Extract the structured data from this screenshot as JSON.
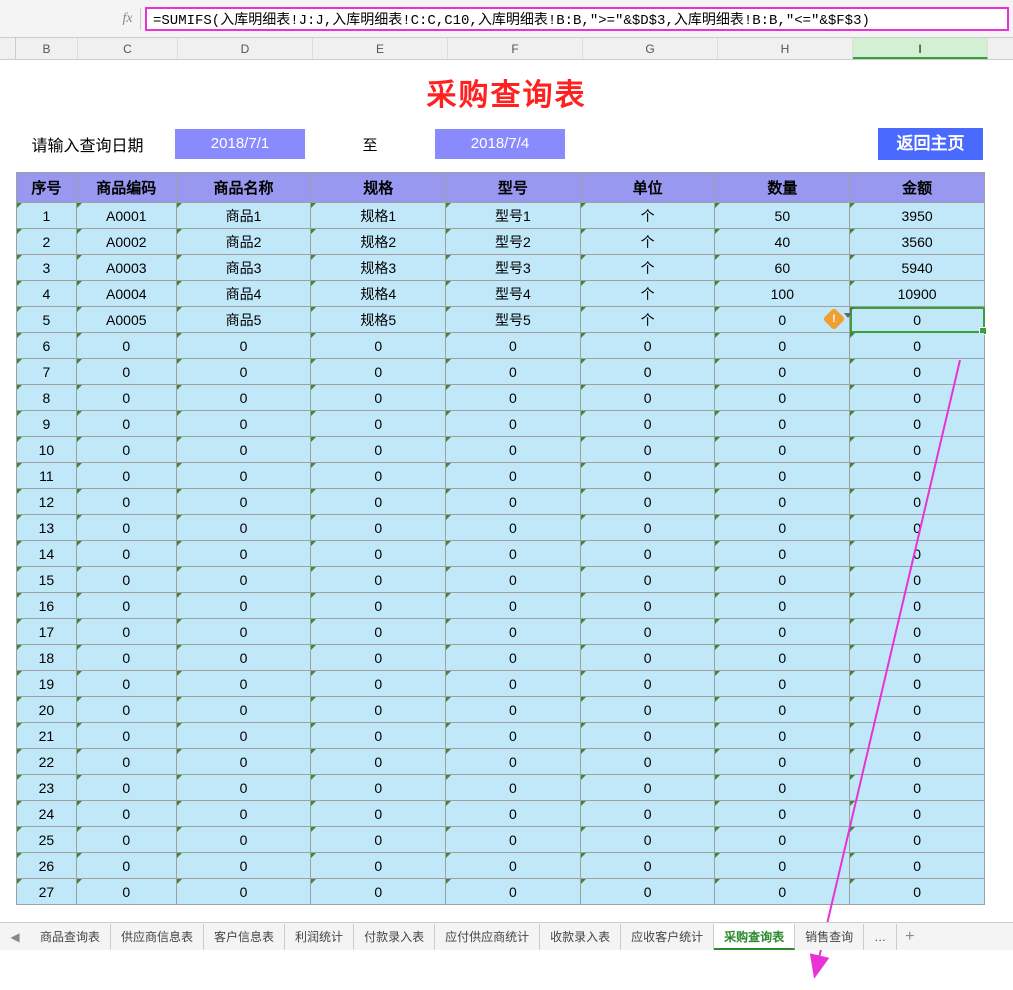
{
  "formula": "=SUMIFS(入库明细表!J:J,入库明细表!C:C,C10,入库明细表!B:B,\">=\"&$D$3,入库明细表!B:B,\"<=\"&$F$3)",
  "fx_label": "fx",
  "columns": [
    "B",
    "C",
    "D",
    "E",
    "F",
    "G",
    "H",
    "I"
  ],
  "selected_col": "I",
  "title": "采购查询表",
  "filter": {
    "label": "请输入查询日期",
    "date_from": "2018/7/1",
    "sep": "至",
    "date_to": "2018/7/4",
    "home": "返回主页"
  },
  "headers": [
    "序号",
    "商品编码",
    "商品名称",
    "规格",
    "型号",
    "单位",
    "数量",
    "金额"
  ],
  "rows": [
    {
      "n": "1",
      "code": "A0001",
      "name": "商品1",
      "spec": "规格1",
      "model": "型号1",
      "unit": "个",
      "qty": "50",
      "amt": "3950"
    },
    {
      "n": "2",
      "code": "A0002",
      "name": "商品2",
      "spec": "规格2",
      "model": "型号2",
      "unit": "个",
      "qty": "40",
      "amt": "3560"
    },
    {
      "n": "3",
      "code": "A0003",
      "name": "商品3",
      "spec": "规格3",
      "model": "型号3",
      "unit": "个",
      "qty": "60",
      "amt": "5940"
    },
    {
      "n": "4",
      "code": "A0004",
      "name": "商品4",
      "spec": "规格4",
      "model": "型号4",
      "unit": "个",
      "qty": "100",
      "amt": "10900"
    },
    {
      "n": "5",
      "code": "A0005",
      "name": "商品5",
      "spec": "规格5",
      "model": "型号5",
      "unit": "个",
      "qty": "0",
      "amt": "0"
    },
    {
      "n": "6",
      "code": "0",
      "name": "0",
      "spec": "0",
      "model": "0",
      "unit": "0",
      "qty": "0",
      "amt": "0"
    },
    {
      "n": "7",
      "code": "0",
      "name": "0",
      "spec": "0",
      "model": "0",
      "unit": "0",
      "qty": "0",
      "amt": "0"
    },
    {
      "n": "8",
      "code": "0",
      "name": "0",
      "spec": "0",
      "model": "0",
      "unit": "0",
      "qty": "0",
      "amt": "0"
    },
    {
      "n": "9",
      "code": "0",
      "name": "0",
      "spec": "0",
      "model": "0",
      "unit": "0",
      "qty": "0",
      "amt": "0"
    },
    {
      "n": "10",
      "code": "0",
      "name": "0",
      "spec": "0",
      "model": "0",
      "unit": "0",
      "qty": "0",
      "amt": "0"
    },
    {
      "n": "11",
      "code": "0",
      "name": "0",
      "spec": "0",
      "model": "0",
      "unit": "0",
      "qty": "0",
      "amt": "0"
    },
    {
      "n": "12",
      "code": "0",
      "name": "0",
      "spec": "0",
      "model": "0",
      "unit": "0",
      "qty": "0",
      "amt": "0"
    },
    {
      "n": "13",
      "code": "0",
      "name": "0",
      "spec": "0",
      "model": "0",
      "unit": "0",
      "qty": "0",
      "amt": "0"
    },
    {
      "n": "14",
      "code": "0",
      "name": "0",
      "spec": "0",
      "model": "0",
      "unit": "0",
      "qty": "0",
      "amt": "0"
    },
    {
      "n": "15",
      "code": "0",
      "name": "0",
      "spec": "0",
      "model": "0",
      "unit": "0",
      "qty": "0",
      "amt": "0"
    },
    {
      "n": "16",
      "code": "0",
      "name": "0",
      "spec": "0",
      "model": "0",
      "unit": "0",
      "qty": "0",
      "amt": "0"
    },
    {
      "n": "17",
      "code": "0",
      "name": "0",
      "spec": "0",
      "model": "0",
      "unit": "0",
      "qty": "0",
      "amt": "0"
    },
    {
      "n": "18",
      "code": "0",
      "name": "0",
      "spec": "0",
      "model": "0",
      "unit": "0",
      "qty": "0",
      "amt": "0"
    },
    {
      "n": "19",
      "code": "0",
      "name": "0",
      "spec": "0",
      "model": "0",
      "unit": "0",
      "qty": "0",
      "amt": "0"
    },
    {
      "n": "20",
      "code": "0",
      "name": "0",
      "spec": "0",
      "model": "0",
      "unit": "0",
      "qty": "0",
      "amt": "0"
    },
    {
      "n": "21",
      "code": "0",
      "name": "0",
      "spec": "0",
      "model": "0",
      "unit": "0",
      "qty": "0",
      "amt": "0"
    },
    {
      "n": "22",
      "code": "0",
      "name": "0",
      "spec": "0",
      "model": "0",
      "unit": "0",
      "qty": "0",
      "amt": "0"
    },
    {
      "n": "23",
      "code": "0",
      "name": "0",
      "spec": "0",
      "model": "0",
      "unit": "0",
      "qty": "0",
      "amt": "0"
    },
    {
      "n": "24",
      "code": "0",
      "name": "0",
      "spec": "0",
      "model": "0",
      "unit": "0",
      "qty": "0",
      "amt": "0"
    },
    {
      "n": "25",
      "code": "0",
      "name": "0",
      "spec": "0",
      "model": "0",
      "unit": "0",
      "qty": "0",
      "amt": "0"
    },
    {
      "n": "26",
      "code": "0",
      "name": "0",
      "spec": "0",
      "model": "0",
      "unit": "0",
      "qty": "0",
      "amt": "0"
    },
    {
      "n": "27",
      "code": "0",
      "name": "0",
      "spec": "0",
      "model": "0",
      "unit": "0",
      "qty": "0",
      "amt": "0"
    }
  ],
  "selected_row_index": 4,
  "warn_icon": "!",
  "tabs": [
    "商品查询表",
    "供应商信息表",
    "客户信息表",
    "利润统计",
    "付款录入表",
    "应付供应商统计",
    "收款录入表",
    "应收客户统计",
    "采购查询表",
    "销售查询"
  ],
  "active_tab": "采购查询表",
  "tab_more": "…",
  "tab_add": "+",
  "nav_left": "◀"
}
